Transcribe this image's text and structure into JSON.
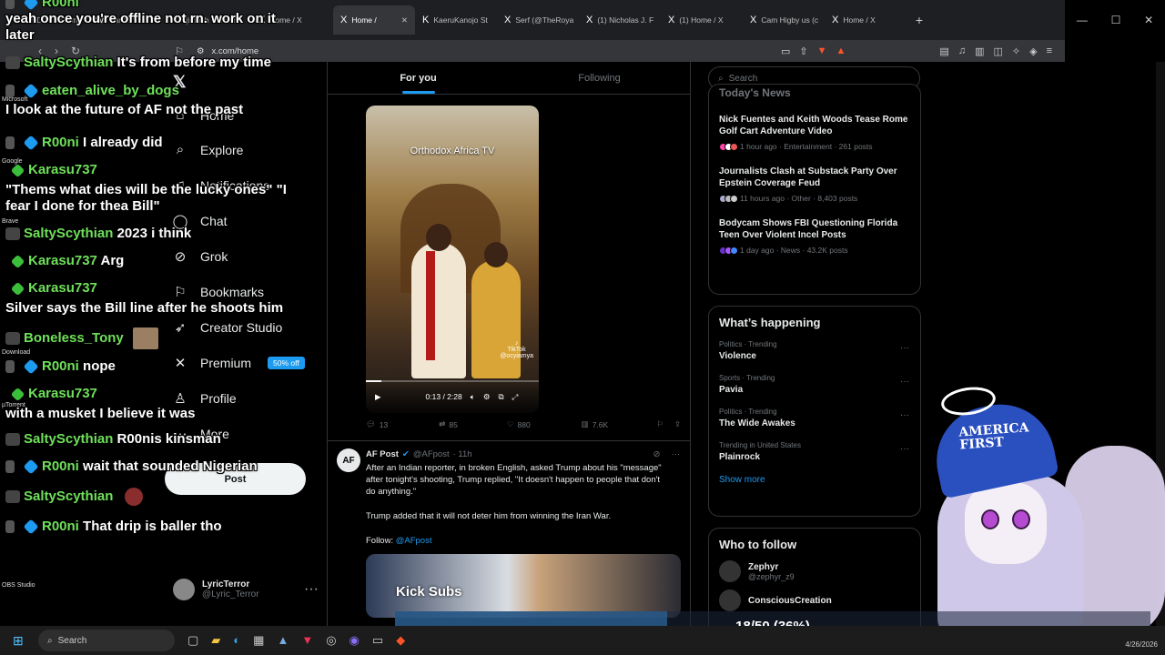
{
  "browser": {
    "tabs": [
      {
        "label": "SHIDO: Stream",
        "icon": "S"
      },
      {
        "label": "wanzerbot",
        "icon": "W"
      },
      {
        "label": "jimbob - Watch",
        "icon": "J"
      },
      {
        "label": "Home / X",
        "icon": "X"
      },
      {
        "label": "Home /",
        "icon": "X"
      },
      {
        "label": "KaeruKanojo St",
        "icon": "K"
      },
      {
        "label": "Serf (@TheRoya",
        "icon": "X"
      },
      {
        "label": "(1) Nicholas J. F",
        "icon": "X"
      },
      {
        "label": "(1) Home / X",
        "icon": "X"
      },
      {
        "label": "Cam Higby us (c",
        "icon": "X"
      },
      {
        "label": "Home / X",
        "icon": "X"
      }
    ],
    "url": "x.com/home"
  },
  "nav": {
    "items": [
      {
        "label": "Home",
        "icon": "home-icon"
      },
      {
        "label": "Explore",
        "icon": "search-icon"
      },
      {
        "label": "Notifications",
        "icon": "bell-icon"
      },
      {
        "label": "Chat",
        "icon": "chat-icon"
      },
      {
        "label": "Grok",
        "icon": "grok-icon"
      },
      {
        "label": "Bookmarks",
        "icon": "bookmark-icon"
      },
      {
        "label": "Creator Studio",
        "icon": "rocket-icon"
      },
      {
        "label": "Premium",
        "icon": "x-icon"
      },
      {
        "label": "Profile",
        "icon": "person-icon"
      },
      {
        "label": "More",
        "icon": "more-icon"
      }
    ],
    "premium_badge": "50% off",
    "post_button": "Post",
    "account": {
      "name": "LyricTerror",
      "handle": "@Lyric_Terror"
    }
  },
  "feed": {
    "tabs": [
      "For you",
      "Following"
    ],
    "video": {
      "title": "Orthodox Africa TV",
      "watermark": "TikTok",
      "watermark_handle": "@ocyiamya",
      "time": "0:13 / 2:28",
      "progress": 0.09
    },
    "post1_stats": {
      "replies": "13",
      "reposts": "85",
      "likes": "880",
      "views": "7.6K"
    },
    "post2": {
      "name": "AF Post",
      "avatar": "AF",
      "handle": "@AFpost",
      "time": "· 11h",
      "para1": "After an Indian reporter, in broken English, asked Trump about his \"message\" after tonight's shooting, Trump replied, \"It doesn't happen to people that don't do anything.\"",
      "para2": "Trump added that it will not deter him from winning the Iran War.",
      "follow_prefix": "Follow: ",
      "follow_link": "@AFpost"
    }
  },
  "sidebar": {
    "search_placeholder": "Search",
    "todays_news_title": "Today's News",
    "news": [
      {
        "title": "Nick Fuentes and Keith Woods Tease Rome Golf Cart Adventure Video",
        "meta": "1 hour ago · Entertainment · 261 posts"
      },
      {
        "title": "Journalists Clash at Substack Party Over Epstein Coverage Feud",
        "meta": "11 hours ago · Other · 8,403 posts"
      },
      {
        "title": "Bodycam Shows FBI Questioning Florida Teen Over Violent Incel Posts",
        "meta": "1 day ago · News · 43.2K posts"
      }
    ],
    "happening_title": "What’s happening",
    "trends": [
      {
        "context": "Politics · Trending",
        "name": "Violence"
      },
      {
        "context": "Sports · Trending",
        "name": "Pavia"
      },
      {
        "context": "Politics · Trending",
        "name": "The Wide Awakes"
      },
      {
        "context": "Trending in United States",
        "name": "Plainrock"
      }
    ],
    "show_more": "Show more",
    "who_to_follow_title": "Who to follow",
    "follow": [
      {
        "name": "Zephyr",
        "handle": "@zephyr_z9"
      },
      {
        "name": "ConsciousCreation",
        "handle": ""
      }
    ]
  },
  "chat": [
    {
      "user": "R00ni",
      "text": ""
    },
    {
      "user": "",
      "text": "yeah once you're offline not rn. work on it"
    },
    {
      "user": "",
      "text": "later"
    },
    {
      "user": "SaltyScythian",
      "text": "It's from before my time"
    },
    {
      "user": "eaten_alive_by_dogs",
      "text": ""
    },
    {
      "user": "",
      "text": "I look at the future of AF not the past"
    },
    {
      "user": "R00ni",
      "text": "I already did"
    },
    {
      "user": "Karasu737",
      "text": ""
    },
    {
      "user": "",
      "text": "\"Thems what dies will be the lucky ones\" \"I"
    },
    {
      "user": "",
      "text": "fear I done for thea Bill\""
    },
    {
      "user": "SaltyScythian",
      "text": "2023 i think"
    },
    {
      "user": "Karasu737",
      "text": "Arg"
    },
    {
      "user": "Karasu737",
      "text": ""
    },
    {
      "user": "",
      "text": "Silver says the Bill line after he shoots him"
    },
    {
      "user": "Boneless_Tony",
      "text": ""
    },
    {
      "user": "R00ni",
      "text": "nope"
    },
    {
      "user": "Karasu737",
      "text": ""
    },
    {
      "user": "",
      "text": "with a musket I believe it was"
    },
    {
      "user": "SaltyScythian",
      "text": "R00nis kinsman"
    },
    {
      "user": "R00ni",
      "text": "wait that sounded Nigerian"
    },
    {
      "user": "SaltyScythian",
      "text": ""
    },
    {
      "user": "R00ni",
      "text": "That drip is baller tho"
    }
  ],
  "desktop_labels": [
    "Microsoft",
    "Google",
    "Brave",
    "Download",
    "µTorrent",
    "OBS Studio"
  ],
  "overlay": {
    "kick_label": "Kick Subs",
    "goal_text": "18/50 (36%)",
    "goal_fraction": 0.36,
    "hat_text": "AMERICA FIRST"
  },
  "taskbar": {
    "search": "Search",
    "date": "4/26/2026"
  }
}
